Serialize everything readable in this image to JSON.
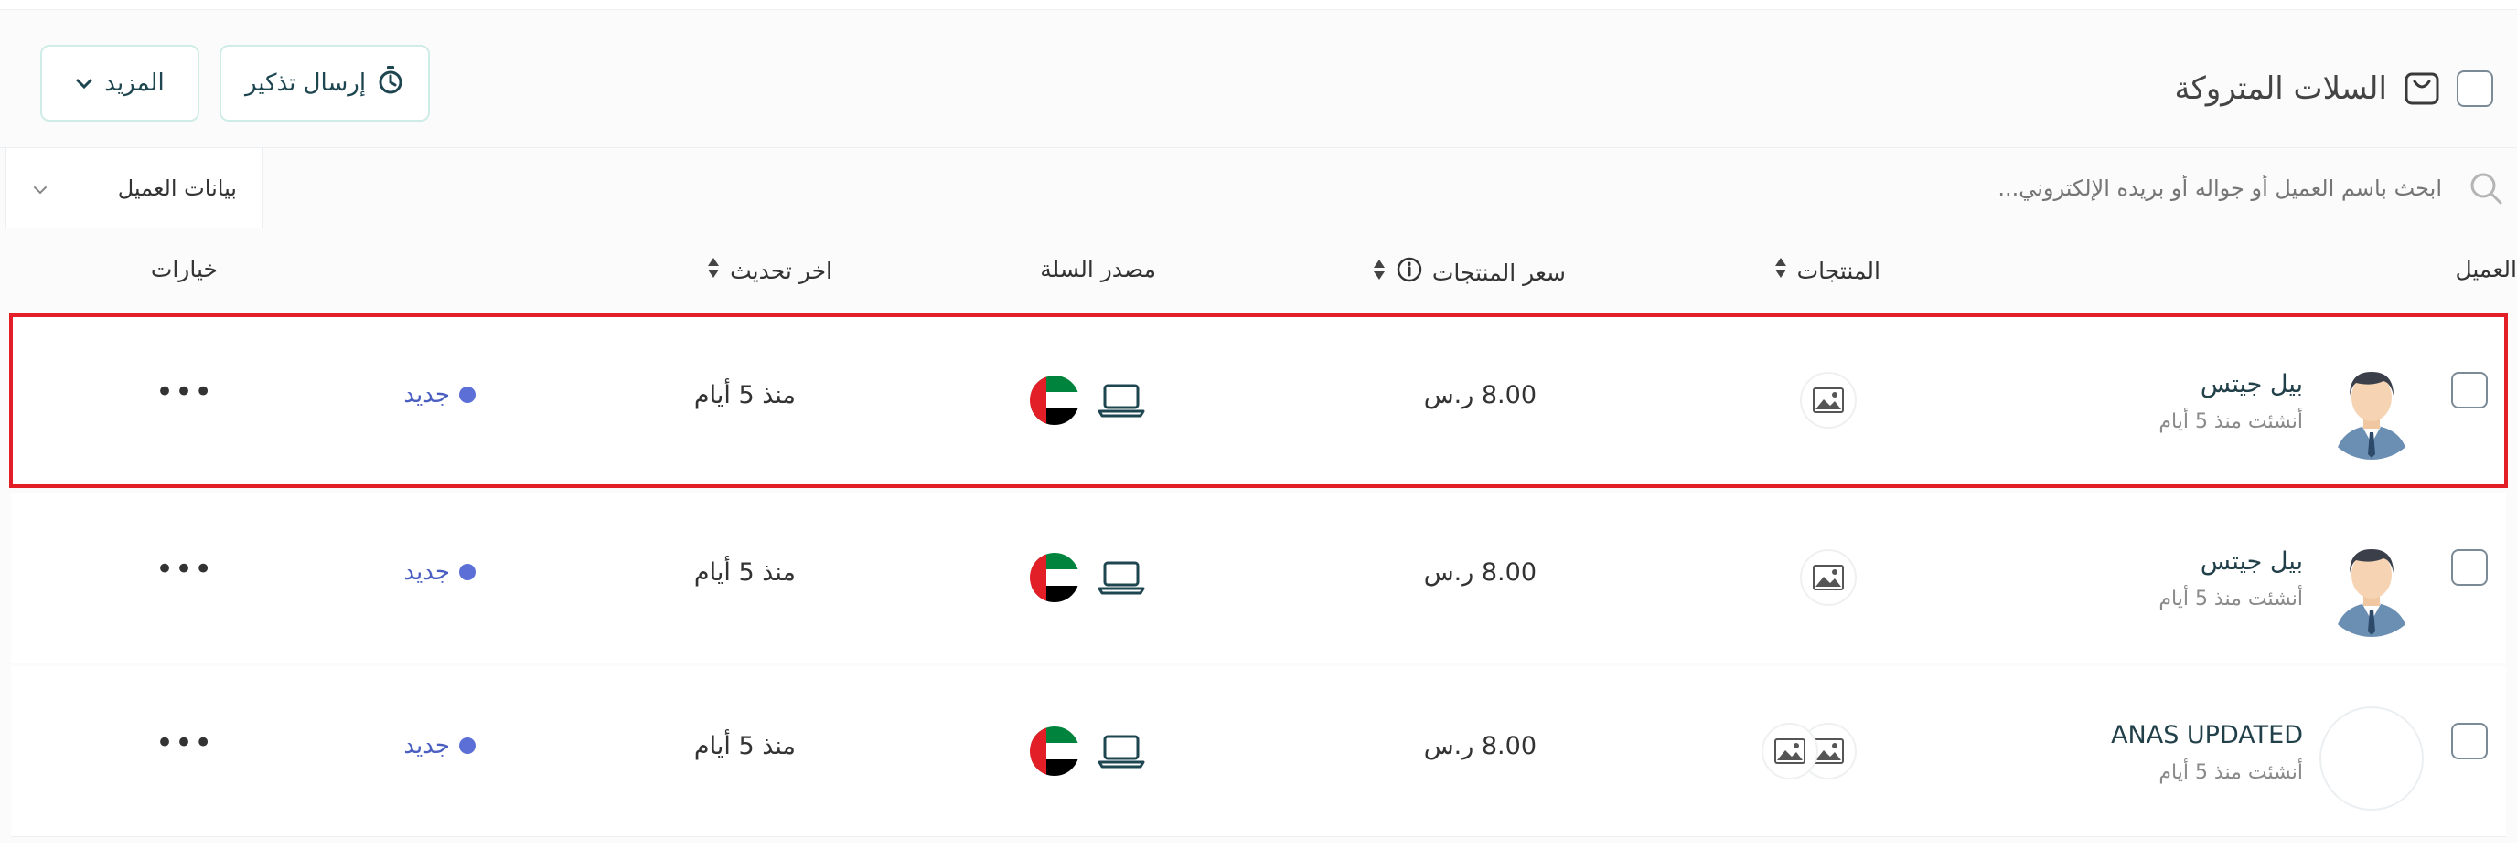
{
  "header": {
    "title": "السلات المتروكة",
    "send_reminder_label": "إرسال تذكير",
    "more_label": "المزيد"
  },
  "search": {
    "placeholder": "ابحث باسم العميل أو جواله أو بريده الإلكتروني..."
  },
  "filter": {
    "selected": "بيانات العميل"
  },
  "table": {
    "columns": {
      "customer": "العميل",
      "products": "المنتجات",
      "price": "سعر المنتجات",
      "source": "مصدر السلة",
      "last_update": "اخر تحديث",
      "options": "خيارات"
    },
    "rows": [
      {
        "customer_name": "بيل جيتس",
        "created": "أنشئت منذ 5 أيام",
        "price": "8.00 ر.س",
        "last_update": "منذ 5 أيام",
        "status": "جديد",
        "product_icons": [
          "image-icon"
        ],
        "avatar": "person-avatar",
        "source_icons": [
          "laptop-icon",
          "uae-flag-icon"
        ]
      },
      {
        "customer_name": "بيل جيتس",
        "created": "أنشئت منذ 5 أيام",
        "price": "8.00 ر.س",
        "last_update": "منذ 5 أيام",
        "status": "جديد",
        "product_icons": [
          "image-icon"
        ],
        "avatar": "person-avatar",
        "source_icons": [
          "laptop-icon",
          "uae-flag-icon"
        ]
      },
      {
        "customer_name": "ANAS UPDATED",
        "created": "أنشئت منذ 5 أيام",
        "price": "8.00 ر.س",
        "last_update": "منذ 5 أيام",
        "status": "جديد",
        "product_icons": [
          "image-icon",
          "image-icon"
        ],
        "avatar": "blank-avatar",
        "source_icons": [
          "laptop-icon",
          "uae-flag-icon"
        ]
      }
    ]
  },
  "colors": {
    "accent": "#1e4650",
    "status": "#5b6fd6",
    "highlight": "#e21f26",
    "button_border": "#cfece6"
  }
}
